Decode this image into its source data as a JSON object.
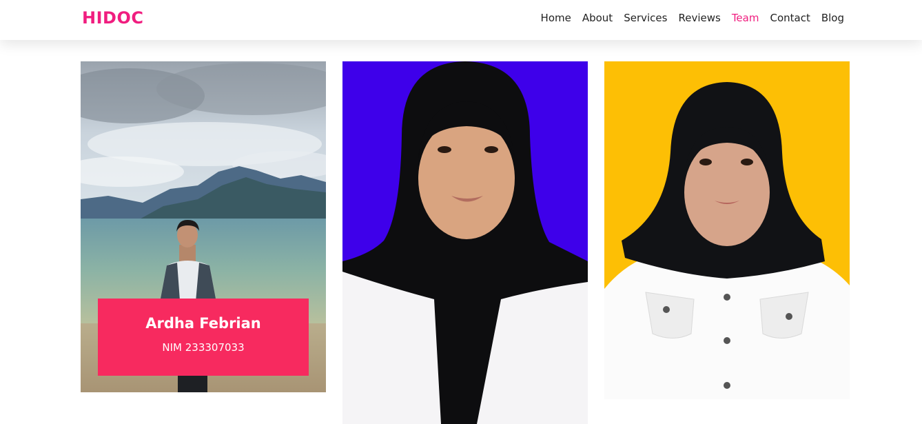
{
  "brand": {
    "logo": "HIDOC",
    "color": "#f01d7f"
  },
  "nav": {
    "items": [
      {
        "label": "Home"
      },
      {
        "label": "About"
      },
      {
        "label": "Services"
      },
      {
        "label": "Reviews"
      },
      {
        "label": "Team",
        "active": true
      },
      {
        "label": "Contact"
      },
      {
        "label": "Blog"
      }
    ]
  },
  "team": [
    {
      "photo": "beach-portrait-man",
      "name": "Ardha Febrian",
      "nim": "NIM 233307033",
      "caption_color": "#f72a5f"
    },
    {
      "photo": "hijab-portrait-blue-background",
      "background": "#3e00ea"
    },
    {
      "photo": "hijab-portrait-yellow-background",
      "background": "#fdbf05"
    }
  ]
}
